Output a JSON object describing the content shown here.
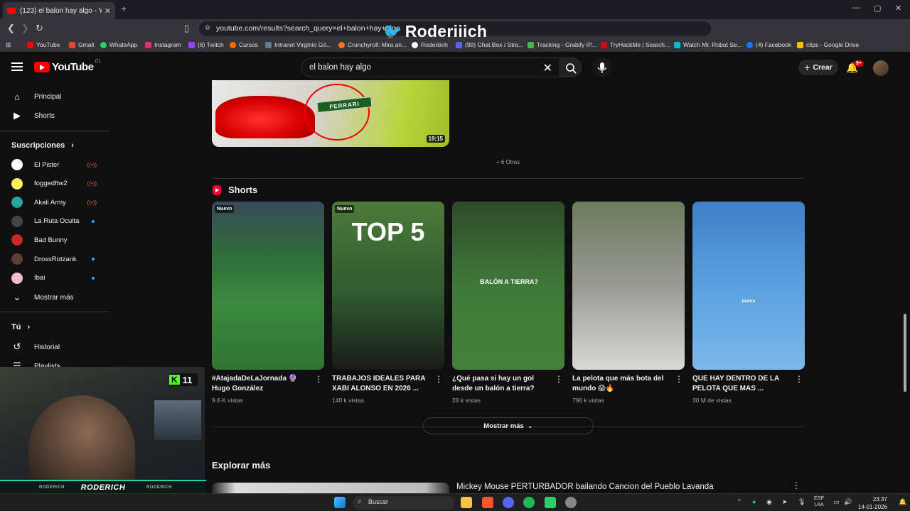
{
  "browser": {
    "tab_title": "(123) el balon hay algo - YouTube",
    "url": "youtube.com/results?search_query=el+balon+hay+algo",
    "brand_overlay": "Roderiiich"
  },
  "bookmarks": [
    {
      "label": "YouTube",
      "color": "#ff0000"
    },
    {
      "label": "Gmail",
      "color": "#ea4335"
    },
    {
      "label": "WhatsApp",
      "color": "#25d366"
    },
    {
      "label": "Instagram",
      "color": "#e1306c"
    },
    {
      "label": "(6) Twitch",
      "color": "#9146ff"
    },
    {
      "label": "Cursos",
      "color": "#ff6f00"
    },
    {
      "label": "Intranet Virginio Gó...",
      "color": "#607d8b"
    },
    {
      "label": "Crunchyroll: Mira an...",
      "color": "#f47521"
    },
    {
      "label": "Roderiiich",
      "color": "#ffffff"
    },
    {
      "label": "(99) Chat Box / Stre...",
      "color": "#5865f2"
    },
    {
      "label": "Tracking - Grabify IP...",
      "color": "#4caf50"
    },
    {
      "label": "TryHackMe | Search...",
      "color": "#c11111"
    },
    {
      "label": "Watch Mr. Robot Se...",
      "color": "#00bcd4"
    },
    {
      "label": "(4) Facebook",
      "color": "#1877f2"
    },
    {
      "label": "clips - Google Drive",
      "color": "#fbbc04"
    }
  ],
  "youtube": {
    "logo_text": "YouTube",
    "country": "CL",
    "search_value": "el balon hay algo",
    "create_label": "Crear",
    "notifications": "9+"
  },
  "sidebar": {
    "main": [
      {
        "label": "Principal",
        "icon": "home-icon"
      },
      {
        "label": "Shorts",
        "icon": "shorts-icon"
      }
    ],
    "subs_header": "Suscripciones",
    "subscriptions": [
      {
        "name": "El Pister",
        "status": "live",
        "color": "#ffffff"
      },
      {
        "name": "foggedftw2",
        "status": "live",
        "color": "#ffee58"
      },
      {
        "name": "Akali Army",
        "status": "live",
        "color": "#26a69a"
      },
      {
        "name": "La Ruta Oculta",
        "status": "new",
        "color": "#444444"
      },
      {
        "name": "Bad Bunny",
        "status": "",
        "color": "#c62828"
      },
      {
        "name": "DrossRotzank",
        "status": "new",
        "color": "#5d4037"
      },
      {
        "name": "Ibai",
        "status": "new",
        "color": "#f8bbd0"
      }
    ],
    "show_more": "Mostrar más",
    "you_header": "Tú",
    "you_items": [
      {
        "label": "Historial",
        "icon": "history-icon"
      },
      {
        "label": "Playlists",
        "icon": "playlists-icon"
      }
    ]
  },
  "streamer": {
    "name": "RODERICH",
    "kick_followers": "11",
    "tag": "RODERICH"
  },
  "main": {
    "video_duration": "19:15",
    "thumb_banner": "FERRARI",
    "others": "+ 6 Otros",
    "shorts_header": "Shorts",
    "shorts": [
      {
        "title": "#AtajadaDeLaJornada 🔮 Hugo González",
        "views": "9.6 K vistas",
        "badge": "Nuevo",
        "bg": "linear-gradient(180deg,#3a4a5a 0%,#2e6b3a 30%,#3b8a3f 60%,#2f7333 100%)",
        "overlay": ""
      },
      {
        "title": "TRABAJOS IDEALES PARA XABI ALONSO EN 2026 ...",
        "views": "140 k vistas",
        "badge": "Nuevo",
        "bg": "linear-gradient(180deg,#4c7a3a 0%,#2f5b2f 55%,#1a1a1a 100%)",
        "overlay": "TOP 5"
      },
      {
        "title": "¿Qué pasa si hay un gol desde un balón a tierra?",
        "views": "28 k vistas",
        "badge": "",
        "bg": "linear-gradient(180deg,#2e4a2a 0%,#3f7a3a 50%,#467f3c 100%)",
        "overlay": "BALÓN A TIERRA?"
      },
      {
        "title": "La pelota que más bota del mundo 😱🔥",
        "views": "796 k vistas",
        "badge": "",
        "bg": "linear-gradient(180deg,#6b7a5c 0%,#9a9a95 50%,#d8d8d6 100%)",
        "overlay": ""
      },
      {
        "title": "QUE HAY DENTRO DE LA PELOTA QUE MAS ...",
        "views": "30 M de vistas",
        "badge": "",
        "bg": "linear-gradient(180deg,#3f7fc9 0%,#5ba0e0 50%,#7cb8ea 100%)",
        "overlay": "dentro"
      }
    ],
    "show_more": "Mostrar más",
    "explore_header": "Explorar más",
    "explore_title": "Mickey Mouse PERTURBADOR bailando Cancion del Pueblo Lavanda"
  },
  "taskbar": {
    "search": "Buscar",
    "lang1": "ESP",
    "lang2": "LAA",
    "time": "23:37",
    "date": "14-01-2026"
  }
}
